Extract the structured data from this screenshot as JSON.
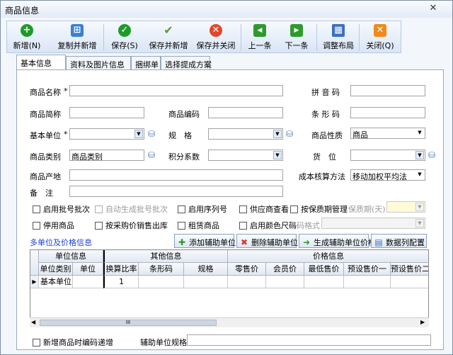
{
  "window": {
    "title": "商品信息",
    "close": "✕"
  },
  "toolbar": [
    {
      "name": "new-button",
      "label": "新增(N)",
      "glyph": "+",
      "color": "#1f9a2a"
    },
    {
      "name": "copy-new-button",
      "label": "复制并新增",
      "glyph": "⊞",
      "color": "#3b7fd0"
    },
    {
      "name": "save-button",
      "label": "保存(S)",
      "glyph": "✓",
      "color": "#1f9a2a"
    },
    {
      "name": "save-new-button",
      "label": "保存并新增",
      "glyph": "✔",
      "color": "#5a9a3a"
    },
    {
      "name": "save-close-button",
      "label": "保存并关闭",
      "glyph": "✕",
      "color": "#e0462a"
    },
    {
      "name": "prev-button",
      "label": "上一条",
      "glyph": "◀",
      "color": "#2e9a2e"
    },
    {
      "name": "next-button",
      "label": "下一条",
      "glyph": "▶",
      "color": "#2e9a2e"
    },
    {
      "name": "layout-button",
      "label": "调整布局",
      "glyph": "▦",
      "color": "#3b6fc0"
    },
    {
      "name": "close-button",
      "label": "关闭(Q)",
      "glyph": "✕",
      "color": "#f08a1a"
    }
  ],
  "tabs": [
    "基本信息",
    "资料及图片信息",
    "捆绑单",
    "选择提成方案"
  ],
  "form": {
    "name_label": "商品名称",
    "required_mark": "*",
    "pinyin_label": "拼 音 码",
    "short_name_label": "商品简称",
    "code_label": "商品编码",
    "barcode_label": "条 形 码",
    "unit_label": "基本单位",
    "spec_label": "规　格",
    "nature_label": "商品性质",
    "nature_value": "商品",
    "category_label": "商品类别",
    "category_value": "商品类别",
    "points_label": "积分系数",
    "shelf_label": "货　位",
    "origin_label": "商品产地",
    "cost_method_label": "成本核算方法",
    "cost_method_value": "移动加权平均法",
    "remark_label": "备　注"
  },
  "checks1": [
    "启用批号批次",
    "自动生成批号批次",
    "启用序列号",
    "供应商查看",
    "按保质期管理"
  ],
  "shelf_life_label": "保质期(天)",
  "checks2": [
    "停用商品",
    "按采购价销售出库",
    "租赁商品",
    "启用颜色尺码"
  ],
  "barcode_format_label": "条码格式",
  "multi_unit_link": "多单位及价格信息",
  "grid_buttons": [
    "添加辅助单位",
    "删除辅助单位",
    "生成辅助单位价格",
    "数据列配置"
  ],
  "grid": {
    "groups": [
      "单位信息",
      "其他信息",
      "价格信息"
    ],
    "columns": [
      "单位类别",
      "单位",
      "换算比率",
      "条形码",
      "规格",
      "零售价",
      "会员价",
      "最低售价",
      "预设售价一",
      "预设售价二"
    ],
    "row": {
      "category": "基本单位",
      "ratio": "1"
    }
  },
  "scroll_marker": "III",
  "footer": {
    "check_label": "新增商品时编码递增",
    "aux_spec_label": "辅助单位规格"
  },
  "colors": {
    "accent": "#3b7fd0",
    "link": "#1a3fd6",
    "panel_bg": "#f3f6fb"
  }
}
